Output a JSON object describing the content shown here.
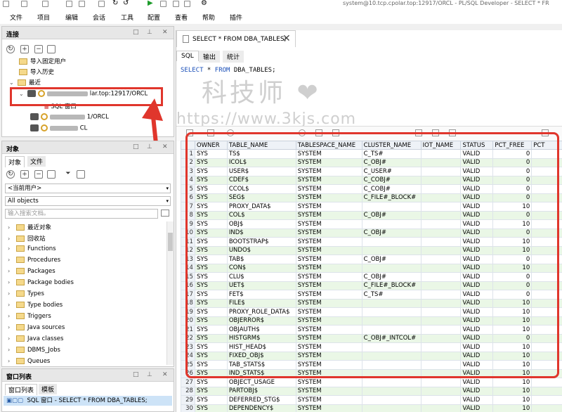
{
  "window": {
    "title": "system@10.tcp.cpolar.top:12917/ORCL - PL/SQL Developer - SELECT * FR"
  },
  "menu": [
    "文件",
    "项目",
    "编辑",
    "会话",
    "工具",
    "配置",
    "查看",
    "帮助",
    "插件"
  ],
  "connections": {
    "title": "连接",
    "items": [
      "导入固定用户",
      "导入历史",
      "最近"
    ],
    "active_conn": "lar.top:12917/ORCL",
    "sql_window": "SQL 窗口",
    "conn2": "1/ORCL",
    "conn3": "CL"
  },
  "objects": {
    "title": "对象",
    "tabs": [
      "对象",
      "文件"
    ],
    "user_select": "<当前用户>",
    "filter_select": "All objects",
    "search_placeholder": "输入搜索文档。",
    "items": [
      "最近对象",
      "回收站",
      "Functions",
      "Procedures",
      "Packages",
      "Package bodies",
      "Types",
      "Type bodies",
      "Triggers",
      "Java sources",
      "Java classes",
      "DBMS_Jobs",
      "Queues"
    ]
  },
  "windows_list": {
    "title": "窗口列表",
    "tabs": [
      "窗口列表",
      "模板"
    ],
    "item": "SQL 窗口 - SELECT * FROM DBA_TABLES;"
  },
  "editor": {
    "tab": "SELECT * FROM DBA_TABLES;",
    "subtabs": [
      "SQL",
      "输出",
      "统计"
    ],
    "sql_select": "SELECT",
    "sql_star": " * ",
    "sql_from": "FROM",
    "sql_rest": " DBA_TABLES;",
    "watermark1": "科技师 ❤",
    "watermark2": "https://www.3kjs.com"
  },
  "grid": {
    "columns": [
      "OWNER",
      "TABLE_NAME",
      "TABLESPACE_NAME",
      "CLUSTER_NAME",
      "IOT_NAME",
      "STATUS",
      "PCT_FREE",
      "PCT"
    ],
    "rows": [
      [
        "1",
        "SYS",
        "TS$",
        "SYSTEM",
        "C_TS#",
        "",
        "VALID",
        "0"
      ],
      [
        "2",
        "SYS",
        "ICOL$",
        "SYSTEM",
        "C_OBJ#",
        "",
        "VALID",
        "0"
      ],
      [
        "3",
        "SYS",
        "USER$",
        "SYSTEM",
        "C_USER#",
        "",
        "VALID",
        "0"
      ],
      [
        "4",
        "SYS",
        "CDEF$",
        "SYSTEM",
        "C_COBJ#",
        "",
        "VALID",
        "0"
      ],
      [
        "5",
        "SYS",
        "CCOL$",
        "SYSTEM",
        "C_COBJ#",
        "",
        "VALID",
        "0"
      ],
      [
        "6",
        "SYS",
        "SEG$",
        "SYSTEM",
        "C_FILE#_BLOCK#",
        "",
        "VALID",
        "0"
      ],
      [
        "7",
        "SYS",
        "PROXY_DATA$",
        "SYSTEM",
        "",
        "",
        "VALID",
        "10"
      ],
      [
        "8",
        "SYS",
        "COL$",
        "SYSTEM",
        "C_OBJ#",
        "",
        "VALID",
        "0"
      ],
      [
        "9",
        "SYS",
        "OBJ$",
        "SYSTEM",
        "",
        "",
        "VALID",
        "10"
      ],
      [
        "10",
        "SYS",
        "IND$",
        "SYSTEM",
        "C_OBJ#",
        "",
        "VALID",
        "0"
      ],
      [
        "11",
        "SYS",
        "BOOTSTRAP$",
        "SYSTEM",
        "",
        "",
        "VALID",
        "10"
      ],
      [
        "12",
        "SYS",
        "UNDO$",
        "SYSTEM",
        "",
        "",
        "VALID",
        "10"
      ],
      [
        "13",
        "SYS",
        "TAB$",
        "SYSTEM",
        "C_OBJ#",
        "",
        "VALID",
        "0"
      ],
      [
        "14",
        "SYS",
        "CON$",
        "SYSTEM",
        "",
        "",
        "VALID",
        "10"
      ],
      [
        "15",
        "SYS",
        "CLU$",
        "SYSTEM",
        "C_OBJ#",
        "",
        "VALID",
        "0"
      ],
      [
        "16",
        "SYS",
        "UET$",
        "SYSTEM",
        "C_FILE#_BLOCK#",
        "",
        "VALID",
        "0"
      ],
      [
        "17",
        "SYS",
        "FET$",
        "SYSTEM",
        "C_TS#",
        "",
        "VALID",
        "0"
      ],
      [
        "18",
        "SYS",
        "FILE$",
        "SYSTEM",
        "",
        "",
        "VALID",
        "10"
      ],
      [
        "19",
        "SYS",
        "PROXY_ROLE_DATA$",
        "SYSTEM",
        "",
        "",
        "VALID",
        "10"
      ],
      [
        "20",
        "SYS",
        "OBJERROR$",
        "SYSTEM",
        "",
        "",
        "VALID",
        "10"
      ],
      [
        "21",
        "SYS",
        "OBJAUTH$",
        "SYSTEM",
        "",
        "",
        "VALID",
        "10"
      ],
      [
        "22",
        "SYS",
        "HISTGRM$",
        "SYSTEM",
        "C_OBJ#_INTCOL#",
        "",
        "VALID",
        "0"
      ],
      [
        "23",
        "SYS",
        "HIST_HEAD$",
        "SYSTEM",
        "",
        "",
        "VALID",
        "10"
      ],
      [
        "24",
        "SYS",
        "FIXED_OBJ$",
        "SYSTEM",
        "",
        "",
        "VALID",
        "10"
      ],
      [
        "25",
        "SYS",
        "TAB_STATS$",
        "SYSTEM",
        "",
        "",
        "VALID",
        "10"
      ],
      [
        "26",
        "SYS",
        "IND_STATS$",
        "SYSTEM",
        "",
        "",
        "VALID",
        "10"
      ],
      [
        "27",
        "SYS",
        "OBJECT_USAGE",
        "SYSTEM",
        "",
        "",
        "VALID",
        "10"
      ],
      [
        "28",
        "SYS",
        "PARTOBJ$",
        "SYSTEM",
        "",
        "",
        "VALID",
        "10"
      ],
      [
        "29",
        "SYS",
        "DEFERRED_STG$",
        "SYSTEM",
        "",
        "",
        "VALID",
        "10"
      ],
      [
        "30",
        "SYS",
        "DEPENDENCY$",
        "SYSTEM",
        "",
        "",
        "VALID",
        "10"
      ]
    ]
  },
  "colors": {
    "highlight": "#e0362c",
    "row_alt": "#eaf7e6",
    "keyword": "#1a4fb8"
  }
}
